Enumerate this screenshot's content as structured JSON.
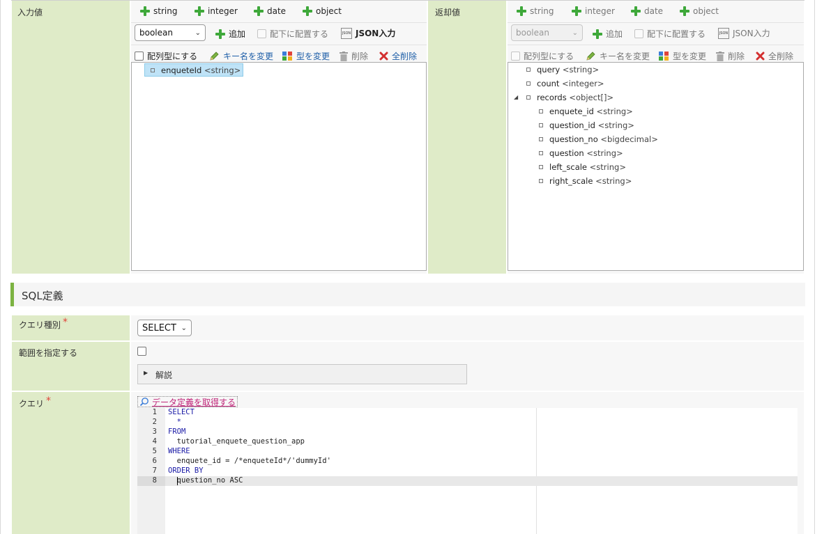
{
  "input_panel": {
    "label": "入力値",
    "type_buttons": [
      "string",
      "integer",
      "date",
      "object"
    ],
    "type_select_value": "boolean",
    "add_label": "追加",
    "place_under_label": "配下に配置する",
    "json_input_label": "JSON入力",
    "array_label": "配列型にする",
    "rename_key_label": "キー名を変更",
    "change_type_label": "型を変更",
    "delete_label": "削除",
    "delete_all_label": "全削除",
    "tree": [
      {
        "name": "enqueteId",
        "type": "<string>",
        "selected": true
      }
    ]
  },
  "output_panel": {
    "label": "返却値",
    "type_buttons": [
      "string",
      "integer",
      "date",
      "object"
    ],
    "type_select_value": "boolean",
    "add_label": "追加",
    "place_under_label": "配下に配置する",
    "json_input_label": "JSON入力",
    "array_label": "配列型にする",
    "rename_key_label": "キー名を変更",
    "change_type_label": "型を変更",
    "delete_label": "削除",
    "delete_all_label": "全削除",
    "tree": [
      {
        "name": "query",
        "type": "<string>",
        "level": 0
      },
      {
        "name": "count",
        "type": "<integer>",
        "level": 0
      },
      {
        "name": "records",
        "type": "<object[]>",
        "level": 0,
        "expanded": true
      },
      {
        "name": "enquete_id",
        "type": "<string>",
        "level": 1
      },
      {
        "name": "question_id",
        "type": "<string>",
        "level": 1
      },
      {
        "name": "question_no",
        "type": "<bigdecimal>",
        "level": 1
      },
      {
        "name": "question",
        "type": "<string>",
        "level": 1
      },
      {
        "name": "left_scale",
        "type": "<string>",
        "level": 1
      },
      {
        "name": "right_scale",
        "type": "<string>",
        "level": 1
      }
    ]
  },
  "sql_section": {
    "title": "SQL定義",
    "query_type_label": "クエリ種別",
    "query_type_value": "SELECT",
    "range_label": "範囲を指定する",
    "explanation_label": "解説",
    "query_label": "クエリ",
    "get_data_def_link": "データ定義を取得する",
    "code_lines": [
      {
        "num": "1",
        "text": "SELECT"
      },
      {
        "num": "2",
        "text": "  *"
      },
      {
        "num": "3",
        "text": "FROM"
      },
      {
        "num": "4",
        "text": "  tutorial_enquete_question_app"
      },
      {
        "num": "5",
        "text": "WHERE"
      },
      {
        "num": "6",
        "text": "  enquete_id = /*enqueteId*/'dummyId'"
      },
      {
        "num": "7",
        "text": "ORDER BY"
      },
      {
        "num": "8",
        "text": "  question_no ASC"
      }
    ]
  },
  "colors": {
    "label_bg": "#dfebc8",
    "accent_green": "#3ea83a",
    "section_accent": "#7cb342",
    "link": "#1f5fa8",
    "data_def_link": "#c0267a"
  }
}
